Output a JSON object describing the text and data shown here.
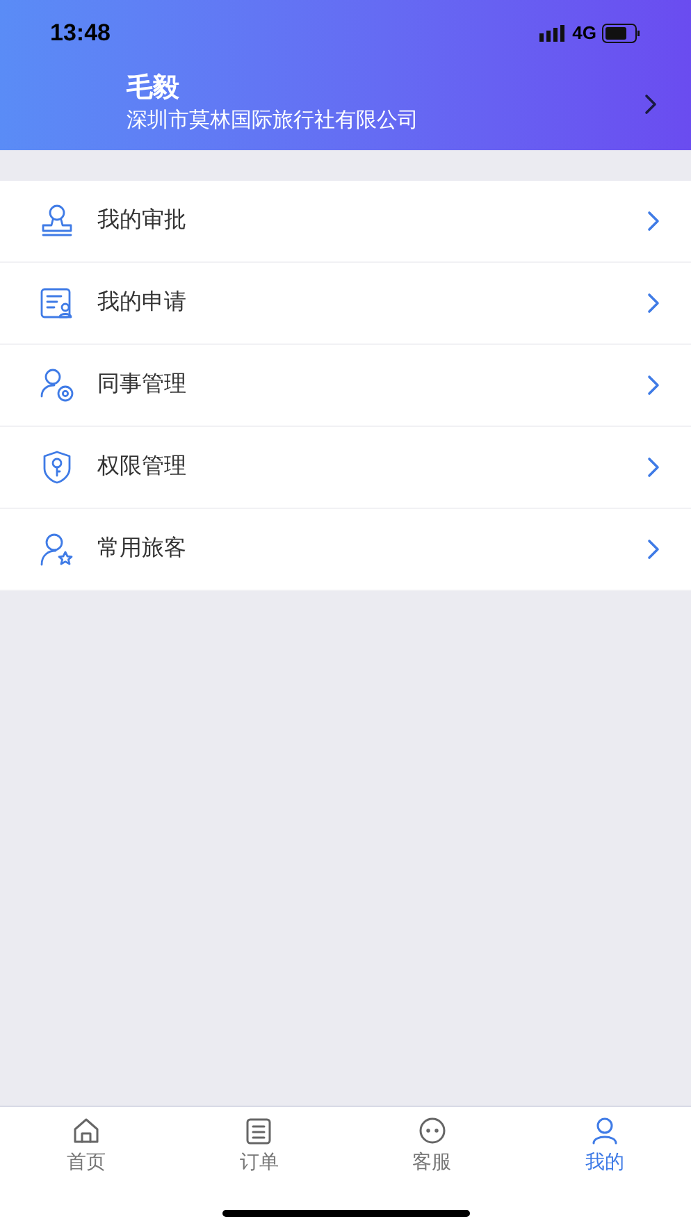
{
  "status_bar": {
    "time": "13:48",
    "network": "4G"
  },
  "profile": {
    "name": "毛毅",
    "company": "深圳市莫林国际旅行社有限公司"
  },
  "menu": [
    {
      "kind": "approval",
      "label": "我的审批"
    },
    {
      "kind": "application",
      "label": "我的申请"
    },
    {
      "kind": "colleagues",
      "label": "同事管理"
    },
    {
      "kind": "permissions",
      "label": "权限管理"
    },
    {
      "kind": "travelers",
      "label": "常用旅客"
    }
  ],
  "tabs": [
    {
      "kind": "home",
      "label": "首页",
      "selected": false
    },
    {
      "kind": "orders",
      "label": "订单",
      "selected": false
    },
    {
      "kind": "service",
      "label": "客服",
      "selected": false
    },
    {
      "kind": "mine",
      "label": "我的",
      "selected": true
    }
  ]
}
